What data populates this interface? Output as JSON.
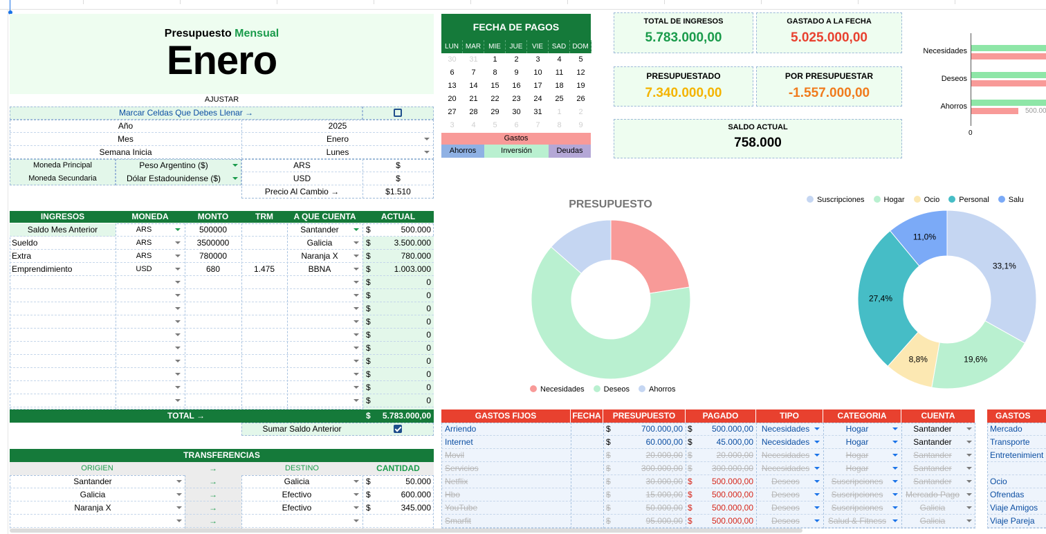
{
  "header": {
    "subtitle_a": "Presupuesto",
    "subtitle_b": "Mensual",
    "month": "Enero",
    "ajustar": "AJUSTAR"
  },
  "settings": {
    "mark_cells_label": "Marcar Celdas Que Debes Llenar →",
    "mark_cells_checked": false,
    "year_label": "Año",
    "year_value": "2025",
    "month_label": "Mes",
    "month_value": "Enero",
    "week_label": "Semana Inicia",
    "week_value": "Lunes",
    "main_currency_label": "Moneda Principal",
    "main_currency_value": "Peso Argentino ($)",
    "main_code": "ARS",
    "main_symbol": "$",
    "second_currency_label": "Moneda Secundaria",
    "second_currency_value": "Dólar Estadounidense ($)",
    "second_code": "USD",
    "second_symbol": "$",
    "exchange_label": "Precio Al Cambio →",
    "exchange_value": "$1.510"
  },
  "calendar": {
    "title": "FECHA DE PAGOS",
    "days": [
      "LUN",
      "MAR",
      "MIE",
      "JUE",
      "VIE",
      "SAD",
      "DOM"
    ],
    "weeks": [
      [
        "30",
        "31",
        "1",
        "2",
        "3",
        "4",
        "5"
      ],
      [
        "6",
        "7",
        "8",
        "9",
        "10",
        "11",
        "12"
      ],
      [
        "13",
        "14",
        "15",
        "16",
        "17",
        "18",
        "19"
      ],
      [
        "20",
        "21",
        "22",
        "23",
        "24",
        "25",
        "26"
      ],
      [
        "27",
        "28",
        "29",
        "30",
        "31",
        "1",
        "2"
      ],
      [
        "3",
        "4",
        "5",
        "6",
        "7",
        "8",
        "9"
      ]
    ],
    "faded_first_row": 2,
    "faded_row5_from": 5,
    "legend_gastos": "Gastos",
    "legend_ahorros": "Ahorros",
    "legend_inversion": "Inversión",
    "legend_deudas": "Deudas"
  },
  "kpis": {
    "ingresos_label": "TOTAL DE INGRESOS",
    "ingresos_value": "5.783.000,00",
    "gastado_label": "GASTADO A LA FECHA",
    "gastado_value": "5.025.000,00",
    "presupuestado_label": "PRESUPUESTADO",
    "presupuestado_value": "7.340.000,00",
    "por_label": "POR PRESUPUESTAR",
    "por_value": "-1.557.000,00",
    "saldo_label": "SALDO ACTUAL",
    "saldo_value": "758.000"
  },
  "bar_chart": {
    "categories": [
      "Necesidades",
      "Deseos",
      "Ahorros"
    ],
    "zero_label": "0",
    "value_label": "500.00"
  },
  "ingresos": {
    "headers": [
      "INGRESOS",
      "MONEDA",
      "MONTO",
      "TRM",
      "A QUE CUENTA",
      "ACTUAL"
    ],
    "rows": [
      {
        "name": "Saldo Mes Anterior",
        "moneda": "ARS",
        "monto": "500000",
        "trm": "",
        "cuenta": "Santander",
        "sym": "$",
        "actual": "500.000"
      },
      {
        "name": "Sueldo",
        "moneda": "ARS",
        "monto": "3500000",
        "trm": "",
        "cuenta": "Galicia",
        "sym": "$",
        "actual": "3.500.000"
      },
      {
        "name": "Extra",
        "moneda": "ARS",
        "monto": "780000",
        "trm": "",
        "cuenta": "Naranja X",
        "sym": "$",
        "actual": "780.000"
      },
      {
        "name": "Emprendimiento",
        "moneda": "USD",
        "monto": "680",
        "trm": "1.475",
        "cuenta": "BBNA",
        "sym": "$",
        "actual": "1.003.000"
      }
    ],
    "empty_sym": "$",
    "empty_val": "0",
    "total_label": "TOTAL →",
    "total_sym": "$",
    "total_value": "5.783.000,00",
    "sumar_label": "Sumar Saldo Anterior",
    "sumar_checked": true
  },
  "transferencias": {
    "title": "TRANSFERENCIAS",
    "headers": [
      "ORIGIEN",
      "→",
      "DESTINO",
      "CANTIDAD"
    ],
    "rows": [
      {
        "origen": "Santander",
        "arrow": "→",
        "destino": "Galicia",
        "sym": "$",
        "cantidad": "50.000"
      },
      {
        "origen": "Galicia",
        "arrow": "→",
        "destino": "Efectivo",
        "sym": "$",
        "cantidad": "600.000"
      },
      {
        "origen": "Naranja X",
        "arrow": "→",
        "destino": "Efectivo",
        "sym": "$",
        "cantidad": "345.000"
      },
      {
        "origen": "",
        "arrow": "→",
        "destino": "",
        "sym": "",
        "cantidad": ""
      }
    ]
  },
  "chart_data": [
    {
      "type": "pie",
      "title": "PRESUPUESTO",
      "categories": [
        "Necesidades",
        "Deseos",
        "Ahorros"
      ],
      "values": [
        22.5,
        64,
        13.5
      ],
      "colors": [
        "#f89a98",
        "#b9f0d0",
        "#c5d6f2"
      ],
      "legend": "bottom"
    },
    {
      "type": "pie",
      "title": "",
      "categories": [
        "Suscripciones",
        "Hogar",
        "Ocio",
        "Personal",
        "Salu"
      ],
      "values": [
        33.1,
        19.6,
        8.8,
        27.4,
        11.0
      ],
      "labels": [
        "33,1%",
        "19,6%",
        "8,8%",
        "27,4%",
        "11,0%"
      ],
      "colors": [
        "#c5d6f2",
        "#b9f0d0",
        "#fce8b2",
        "#46bdc6",
        "#7baaf7"
      ],
      "legend": "top"
    }
  ],
  "gastos_fijos": {
    "headers": [
      "GASTOS FIJOS",
      "FECHA",
      "PRESUPUESTO",
      "PAGADO",
      "TIPO",
      "CATEGORIA",
      "CUENTA"
    ],
    "rows": [
      {
        "name": "Arriendo",
        "presupuesto": "700.000,00",
        "pagado": "500.000,00",
        "tipo": "Necesidades",
        "categoria": "Hogar",
        "cuenta": "Santander",
        "state": "active"
      },
      {
        "name": "Internet",
        "presupuesto": "60.000,00",
        "pagado": "45.000,00",
        "tipo": "Necesidades",
        "categoria": "Hogar",
        "cuenta": "Santander",
        "state": "active"
      },
      {
        "name": "Movil",
        "presupuesto": "20.000,00",
        "pagado": "20.000,00",
        "tipo": "Necesidades",
        "categoria": "Hogar",
        "cuenta": "Santander",
        "state": "done"
      },
      {
        "name": "Servicios",
        "presupuesto": "300.000,00",
        "pagado": "300.000,00",
        "tipo": "Necesidades",
        "categoria": "Hogar",
        "cuenta": "Santander",
        "state": "done"
      },
      {
        "name": "Netflix",
        "presupuesto": "30.000,00",
        "pagado": "500.000,00",
        "tipo": "Deseos",
        "categoria": "Suscripciones",
        "cuenta": "Santander",
        "state": "over"
      },
      {
        "name": "Hbo",
        "presupuesto": "15.000,00",
        "pagado": "500.000,00",
        "tipo": "Deseos",
        "categoria": "Suscripciones",
        "cuenta": "Mercado Pago",
        "state": "over"
      },
      {
        "name": "YouTube",
        "presupuesto": "50.000,00",
        "pagado": "500.000,00",
        "tipo": "Deseos",
        "categoria": "Suscripciones",
        "cuenta": "Galicia",
        "state": "over"
      },
      {
        "name": "Smarfit",
        "presupuesto": "95.000,00",
        "pagado": "500.000,00",
        "tipo": "Deseos",
        "categoria": "Salud & Fitness",
        "cuenta": "Galicia",
        "state": "over"
      }
    ],
    "sym": "$"
  },
  "gastos_variables": {
    "header": "GASTOS VAR",
    "items": [
      "Mercado",
      "Transporte",
      "Entretenimient",
      "",
      "Ocio",
      "Ofrendas",
      "Viaje Amigos",
      "Viaje Pareja"
    ]
  },
  "colors": {
    "green": "#157a3a",
    "accent_green": "#1a9b4b",
    "red_header": "#e8412f",
    "orange": "#f07b1d",
    "amber": "#f4b400",
    "mint": "#eefdf0"
  }
}
